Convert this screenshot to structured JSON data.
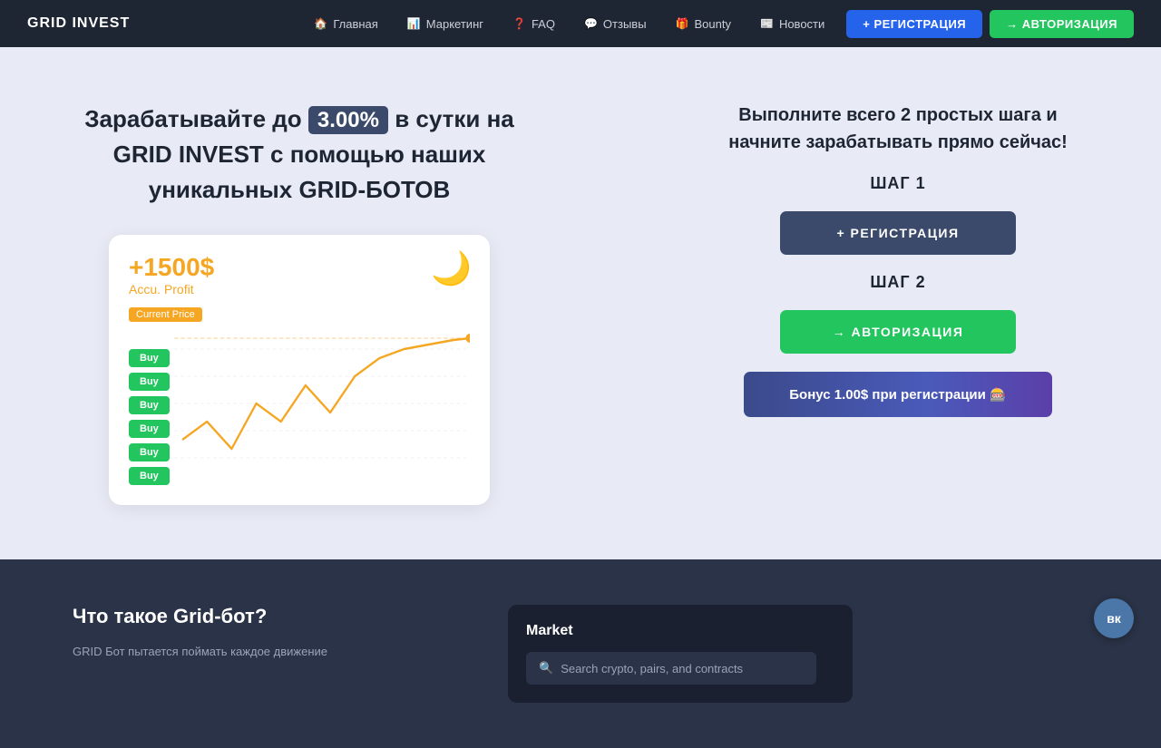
{
  "navbar": {
    "logo": "GRID INVEST",
    "links": [
      {
        "id": "home",
        "icon": "🏠",
        "label": "Главная"
      },
      {
        "id": "marketing",
        "icon": "📊",
        "label": "Маркетинг"
      },
      {
        "id": "faq",
        "icon": "❓",
        "label": "FAQ"
      },
      {
        "id": "reviews",
        "icon": "💬",
        "label": "Отзывы"
      },
      {
        "id": "bounty",
        "icon": "🎁",
        "label": "Bounty"
      },
      {
        "id": "news",
        "icon": "📰",
        "label": "Новости"
      }
    ],
    "btn_reg": "+ РЕГИСТРАЦИЯ",
    "btn_auth": "→ АВТОРИЗАЦИЯ"
  },
  "hero": {
    "title_before": "Зарабатывайте до",
    "highlight": "3.00%",
    "title_after": "в сутки на GRID INVEST с помощью наших уникальных GRID-БОТОВ",
    "card": {
      "profit": "+1500$",
      "profit_label": "Accu. Profit",
      "moon_icon": "🌙",
      "current_price_label": "Current Price",
      "buy_labels": [
        "Buy",
        "Buy",
        "Buy",
        "Buy",
        "Buy",
        "Buy"
      ]
    },
    "right_title": "Выполните всего 2 простых шага и начните зарабатывать прямо сейчас!",
    "step1_label": "ШАГ 1",
    "btn_reg_label": "+ РЕГИСТРАЦИЯ",
    "step2_label": "ШАГ 2",
    "btn_auth_label": "→ АВТОРИЗАЦИЯ",
    "bonus_label": "Бонус 1.00$ при регистрации 🎰"
  },
  "bottom": {
    "title": "Что такое Grid-бот?",
    "desc": "GRID Бот пытается поймать каждое движение",
    "market": {
      "title": "Market",
      "search_placeholder": "Search crypto, pairs, and contracts"
    }
  },
  "vk_label": "вк"
}
